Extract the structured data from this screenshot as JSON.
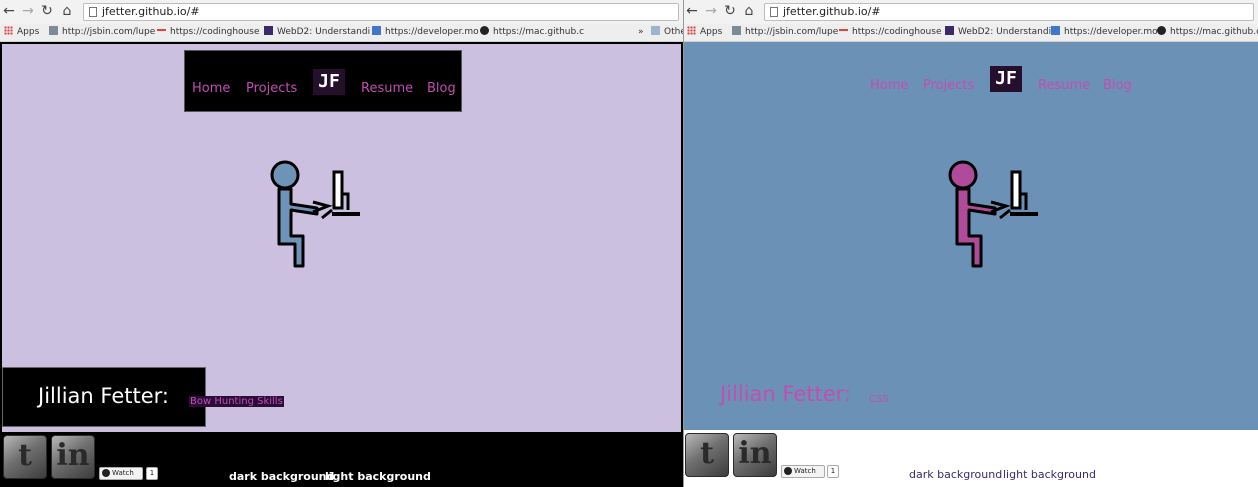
{
  "browser": {
    "url": "jfetter.github.io/#",
    "bookmarks": [
      "Apps",
      "http://jsbin.com/lupe",
      "https://codinghouse",
      "WebD2: Understandi",
      "https://developer.mo",
      "https://mac.github.c"
    ],
    "other_bookmarks_label": "Othe",
    "overflow_chevron": "»"
  },
  "nav": {
    "items": [
      "Home",
      "Projects",
      "Resume",
      "Blog"
    ],
    "logo": "JF"
  },
  "header_left": {
    "name": "Jillian Fetter:",
    "skill": "Bow Hunting Skills"
  },
  "header_right": {
    "name": "Jillian Fetter:",
    "skill": "CSS"
  },
  "footer": {
    "watch_label": "Watch",
    "watch_count": "1",
    "dark_link": "dark background",
    "light_link": "light background",
    "social": [
      "twitter-icon",
      "linkedin-icon"
    ]
  },
  "colors": {
    "light_purple_bg": "#cbc0e0",
    "blue_bg": "#6b92b6",
    "accent_pink": "#c24db3",
    "figure_blue": "#6d93b8",
    "figure_pink": "#b04a9a"
  }
}
